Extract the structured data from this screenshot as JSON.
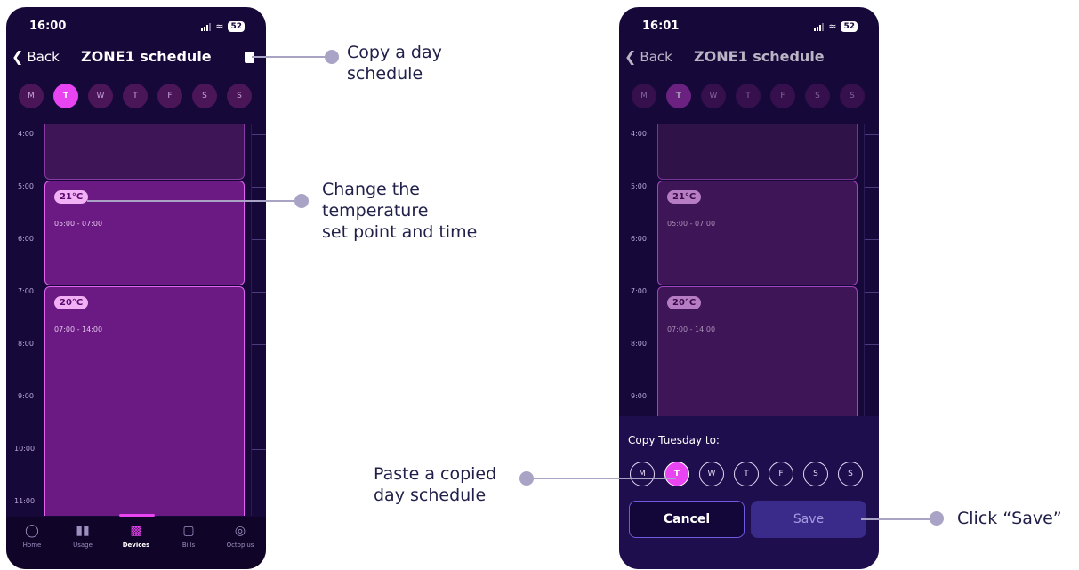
{
  "screen1": {
    "status_time": "16:00",
    "battery": "52",
    "back_label": "Back",
    "title": "ZONE1 schedule",
    "days": [
      "M",
      "T",
      "W",
      "T",
      "F",
      "S",
      "S"
    ],
    "selected_day_index": 1,
    "hours": [
      "4:00",
      "5:00",
      "6:00",
      "7:00",
      "8:00",
      "9:00",
      "10:00",
      "11:00"
    ],
    "blocks": [
      {
        "temp": "21°C",
        "range": "05:00 - 07:00"
      },
      {
        "temp": "20°C",
        "range": "07:00 - 14:00"
      }
    ],
    "tabs": [
      {
        "label": "Home",
        "icon": "home-icon"
      },
      {
        "label": "Usage",
        "icon": "usage-icon"
      },
      {
        "label": "Devices",
        "icon": "devices-icon"
      },
      {
        "label": "Bills",
        "icon": "bills-icon"
      },
      {
        "label": "Octoplus",
        "icon": "octoplus-icon"
      }
    ],
    "active_tab_index": 2
  },
  "screen2": {
    "status_time": "16:01",
    "battery": "52",
    "back_label": "Back",
    "title": "ZONE1 schedule",
    "days": [
      "M",
      "T",
      "W",
      "T",
      "F",
      "S",
      "S"
    ],
    "selected_day_index": 1,
    "hours": [
      "4:00",
      "5:00",
      "6:00",
      "7:00",
      "8:00",
      "9:00"
    ],
    "blocks": [
      {
        "temp": "21°C",
        "range": "05:00 - 07:00"
      },
      {
        "temp": "20°C",
        "range": "07:00 - 14:00"
      }
    ],
    "copy_sheet": {
      "title": "Copy Tuesday to:",
      "days": [
        "M",
        "T",
        "W",
        "T",
        "F",
        "S",
        "S"
      ],
      "selected_day_index": 1,
      "cancel_label": "Cancel",
      "save_label": "Save"
    }
  },
  "callouts": {
    "copy": [
      "Copy a day",
      "schedule"
    ],
    "change": [
      "Change the",
      "temperature",
      "set point and time"
    ],
    "paste": [
      "Paste a copied",
      "day schedule"
    ],
    "save": "Click “Save”"
  },
  "colors": {
    "background": "#17083a",
    "accent": "#e844f2",
    "block": "#6a1a82",
    "callout_line": "#a9a3c5"
  }
}
